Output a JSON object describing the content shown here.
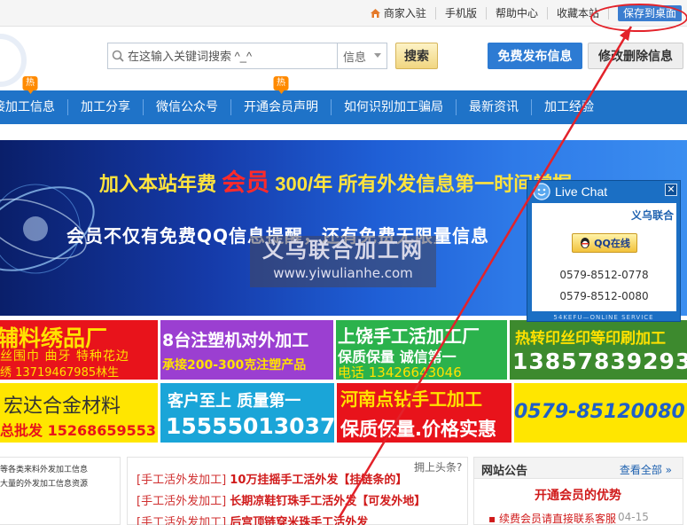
{
  "topbar": {
    "links": [
      "商家入驻",
      "手机版",
      "帮助中心",
      "收藏本站"
    ],
    "save_button": "保存到桌面"
  },
  "header": {
    "search": {
      "placeholder": "在这输入关键词搜索 ^_^",
      "category": "信息"
    },
    "search_button": "搜索",
    "post_button": "免费发布信息",
    "edit_button": "修改删除信息"
  },
  "nav": {
    "items": [
      "接加工信息",
      "加工分享",
      "微信公众号",
      "开通会员声明",
      "如何识别加工骗局",
      "最新资讯",
      "加工经验"
    ],
    "hot_label": "热"
  },
  "banner": {
    "headline_pre": "加入本站年费",
    "headline_highlight": "会员",
    "headline_post": "300/年  所有外发信息第一时间掌握",
    "subline": "会员不仅有免费QQ信息提醒，还有免费无限量信息",
    "watermark_cn": "义乌联合加工网",
    "watermark_url": "www.yiwulianhe.com"
  },
  "livechat": {
    "title": "Live Chat",
    "site": "义乌联合",
    "qq_button": "QQ在线",
    "phone1": "0579-8512-0778",
    "phone2": "0579-8512-0080",
    "footer": "54KEFU—ONLINE SERVICE"
  },
  "ads": [
    {
      "lines": [
        "辅料绣品厂",
        "丝围巾  曲牙  特种花边",
        "绣  13719467985林生"
      ]
    },
    {
      "lines": [
        "8台注塑机对外加工",
        "承接200-300克注塑产品"
      ]
    },
    {
      "lines": [
        "上饶手工活加工厂",
        "保质保量    诚信第一",
        "电话 13426643046"
      ]
    },
    {
      "lines": [
        "热转印丝印等印刷加工",
        "13857839293"
      ]
    },
    {
      "lines": [
        "宏达合金材料",
        "总批发 15268659553"
      ]
    },
    {
      "lines": [
        "客户至上  质量第一",
        "15555013037"
      ]
    },
    {
      "lines": [
        "河南点钻手工加工",
        "保质保量.价格实惠"
      ]
    },
    {
      "lines": [
        "0579-85120080"
      ]
    }
  ],
  "bottom": {
    "left_texts": [
      "等各类来料外发加工信息",
      "大量的外发加工信息资源"
    ],
    "news_tag": "拥上头条?",
    "news": [
      {
        "cat": "[手工活外发加工]",
        "title": "10万挂摇手工活外发【挂链条的】"
      },
      {
        "cat": "[手工活外发加工]",
        "title": "长期凉鞋钉珠手工活外发【可发外地】"
      },
      {
        "cat": "[手工活外发加工]",
        "title": "后宫顶链穿米珠手工活外发"
      }
    ],
    "notice_title": "网站公告",
    "notice_more": "查看全部 »",
    "notice_headline": "开通会员的优势",
    "notice_item": "续费会员请直接联系客服",
    "notice_date": "04-15"
  },
  "colors": {
    "nav": "#1f73c8",
    "accent_red": "#e3222a",
    "banner_yellow": "#ffe33d"
  }
}
